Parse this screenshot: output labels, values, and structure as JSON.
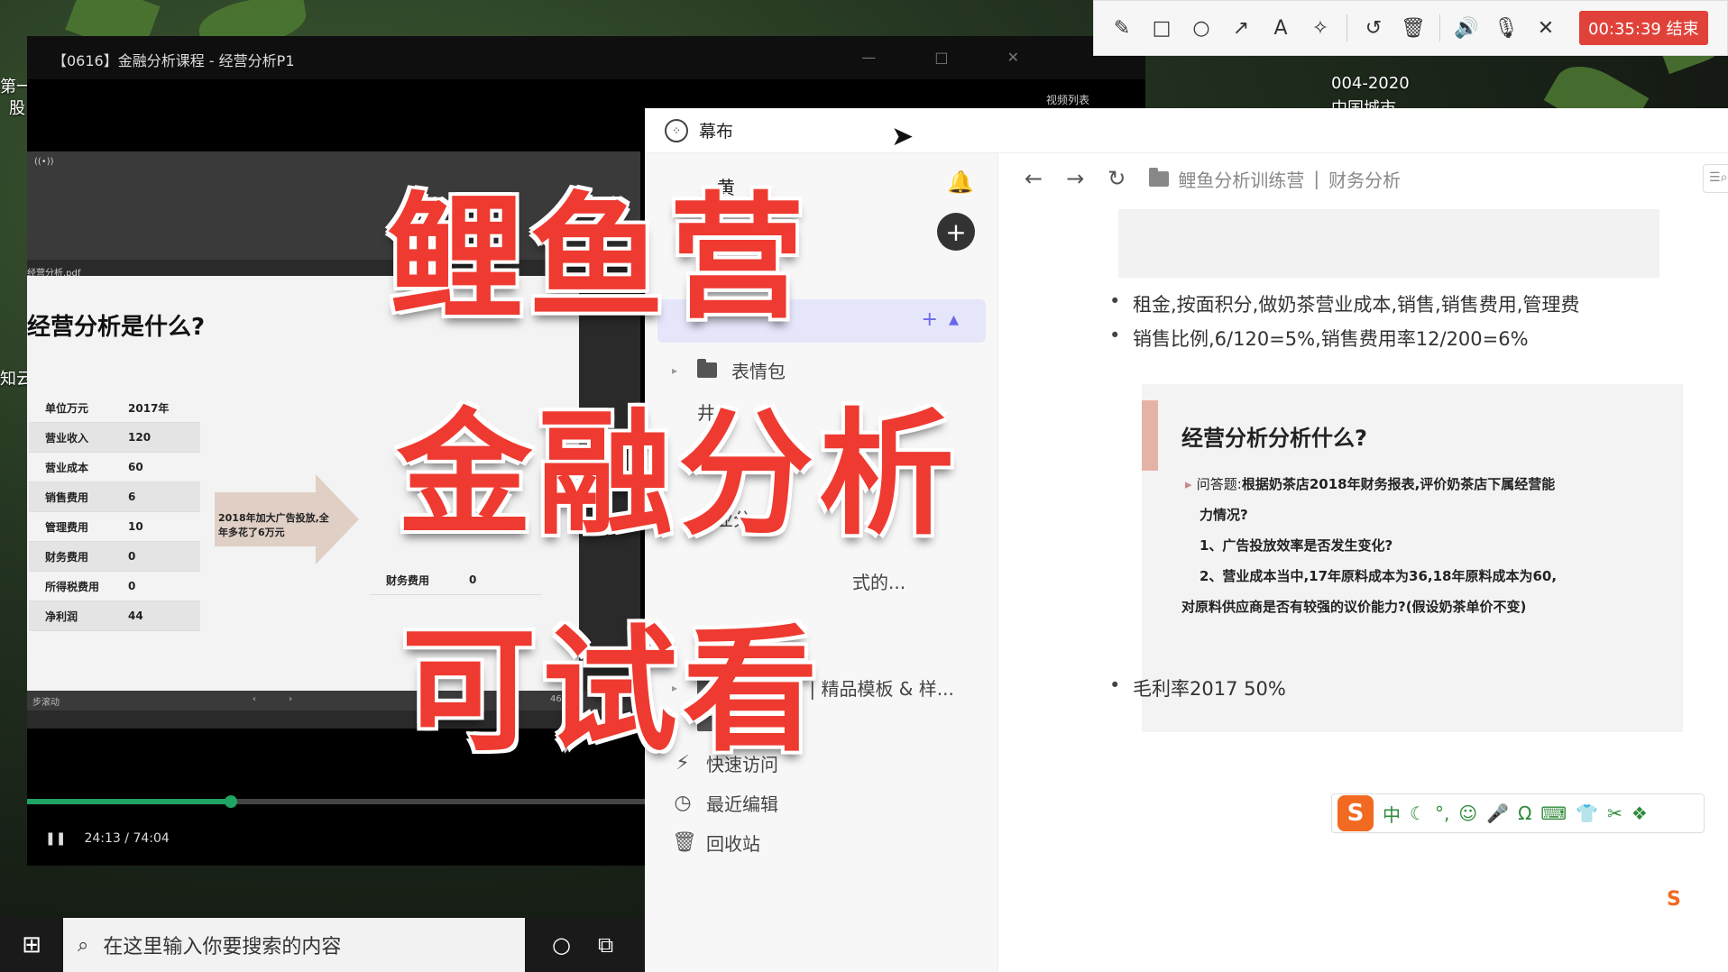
{
  "desktop": {
    "left_labels": [
      "第一",
      "股",
      "知云"
    ],
    "right_label_1": "004-2020",
    "right_label_2": "中国城市"
  },
  "player": {
    "title": "【0616】金融分析课程 - 经营分析P1",
    "sidebar_label": "视频列表",
    "current_time": "24:13",
    "duration": "74:04",
    "progress": 0.327
  },
  "pdf": {
    "filename": "经营分析.pdf",
    "heading": "经营分析是什么?",
    "table_header": [
      "单位万元",
      "2017年"
    ],
    "table_rows": [
      [
        "营业收入",
        "120"
      ],
      [
        "营业成本",
        "60"
      ],
      [
        "销售费用",
        "6"
      ],
      [
        "管理费用",
        "10"
      ],
      [
        "财务费用",
        "0"
      ],
      [
        "所得税费用",
        "0"
      ],
      [
        "净利润",
        "44"
      ]
    ],
    "arrow_note": "2018年加大广告投放,全年多花了6万元",
    "right_table_row": [
      "财务费用",
      "0"
    ],
    "bottom_label": "步滚动",
    "page_num": "46"
  },
  "draw_toolbar": {
    "tools": [
      "pencil-icon",
      "rectangle-icon",
      "circle-icon",
      "arrow-icon",
      "text-icon",
      "magic-icon",
      "undo-icon",
      "trash-icon",
      "speaker-icon",
      "mic-icon",
      "close-icon"
    ],
    "record_label": "00:35:39 结束"
  },
  "app": {
    "name": "幕布",
    "user_short": "黄",
    "sidebar_items": [
      "表情包",
      "井",
      "行业分",
      "示例文档 | 精品模板 & 样..."
    ],
    "folder_problem": "问题",
    "nav": [
      "快速访问",
      "最近编辑",
      "回收站"
    ],
    "misc_text": "式的..."
  },
  "main": {
    "breadcrumb_root": "鲤鱼分析训练营",
    "breadcrumb_sep": "|",
    "breadcrumb_current": "财务分析",
    "bullets": [
      "租金,按面积分,做奶茶营业成本,销售,销售费用,管理费",
      "销售比例,6/120=5%,销售费用率12/200=6%",
      "毛利率2017 50%"
    ],
    "embed": {
      "title": "经营分析分析什么?",
      "q_label": "问答题:",
      "q_text": "根据奶茶店2018年财务报表,评价奶茶店下属经营能",
      "q_text2": "力情况?",
      "item1": "1、广告投放效率是否发生变化?",
      "item2": "2、营业成本当中,17年原料成本为36,18年原料成本为60,",
      "item3": "对原料供应商是否有较强的议价能力?(假设奶茶单价不变)"
    }
  },
  "ime": {
    "logo": "S",
    "items": [
      "中",
      "☾",
      "°,",
      "☺",
      "🎤",
      "Ω",
      "⌨",
      "👕",
      "✂",
      "❖"
    ]
  },
  "taskbar": {
    "search_placeholder": "在这里输入你要搜索的内容"
  },
  "overlay": {
    "line1": "鲤鱼营",
    "line2": "金融分析",
    "line3": "可试看"
  },
  "colors": {
    "headline": "#ee3a30",
    "accent_green": "#1fa463",
    "record": "#e0423a"
  }
}
